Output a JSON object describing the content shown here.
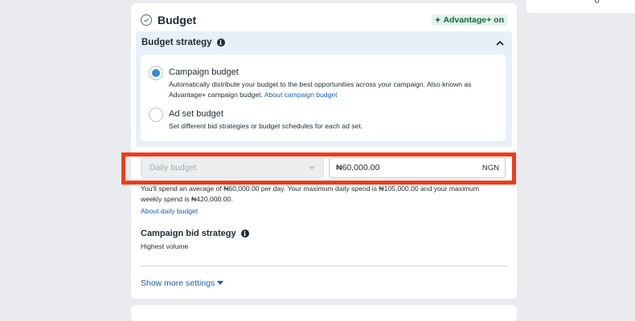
{
  "side_panel": {
    "fragment": "()"
  },
  "budget": {
    "title": "Budget",
    "advantage_badge": "Advantage+ on",
    "strategy": {
      "title": "Budget strategy",
      "options": [
        {
          "label": "Campaign budget",
          "selected": true,
          "description": "Automatically distribute your budget to the best opportunities across your campaign. Also known as Advantage+ campaign budget.",
          "link": "About campaign budget"
        },
        {
          "label": "Ad set budget",
          "selected": false,
          "description": "Set different bid strategies or budget schedules for each ad set."
        }
      ]
    },
    "budget_type": {
      "value": "Daily budget"
    },
    "amount": {
      "value": "₦60,000.00",
      "currency": "NGN"
    },
    "spend_note": "You'll spend an average of ₦60,000.00 per day. Your maximum daily spend is ₦105,000.00 and your maximum weekly spend is ₦420,000.00.",
    "about_daily_link": "About daily budget",
    "bid_strategy": {
      "title": "Campaign bid strategy",
      "value": "Highest volume"
    },
    "show_more": "Show more settings"
  },
  "colors": {
    "accent": "#1662b0",
    "highlight": "#f23a1a",
    "badge_text": "#126b3a"
  }
}
